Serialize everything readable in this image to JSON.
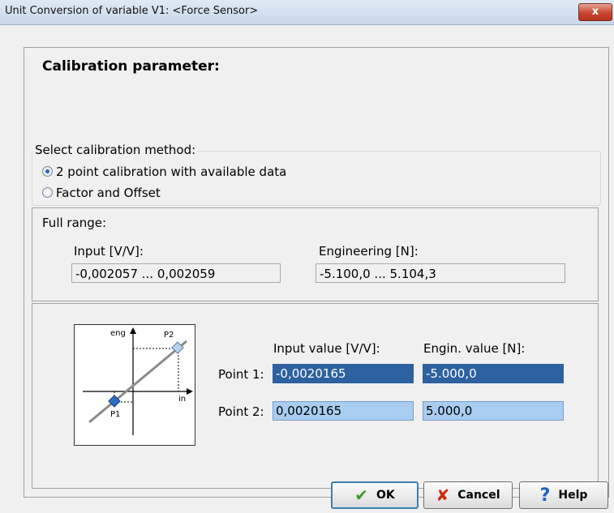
{
  "window": {
    "title": "Unit Conversion of variable V1: <Force Sensor>",
    "close_label": "x"
  },
  "heading": "Calibration parameter:",
  "method": {
    "legend": "Select calibration method:",
    "options": [
      {
        "label": "2 point calibration with available data",
        "checked": true
      },
      {
        "label": "Factor and Offset",
        "checked": false
      }
    ]
  },
  "full_range": {
    "label": "Full range:",
    "input_label": "Input [V/V]:",
    "input_value": "-0,002057 ... 0,002059",
    "engineering_label": "Engineering [N]:",
    "engineering_value": "-5.100,0 ... 5.104,3"
  },
  "diagram": {
    "y_axis": "eng",
    "x_axis": "in",
    "p1": "P1",
    "p2": "P2"
  },
  "points": {
    "input_header": "Input value [V/V]:",
    "engin_header": "Engin. value [N]:",
    "rows": [
      {
        "label": "Point 1:",
        "input": "-0,0020165",
        "engin": "-5.000,0"
      },
      {
        "label": "Point 2:",
        "input": "0,0020165",
        "engin": "5.000,0"
      }
    ]
  },
  "buttons": {
    "ok": "OK",
    "cancel": "Cancel",
    "help": "Help"
  },
  "colors": {
    "selected_field": "#2e619f",
    "field": "#a8cdf0",
    "ok_check": "#3a9a2a",
    "cancel_x": "#cc2a10",
    "help_q": "#1a63c8"
  }
}
